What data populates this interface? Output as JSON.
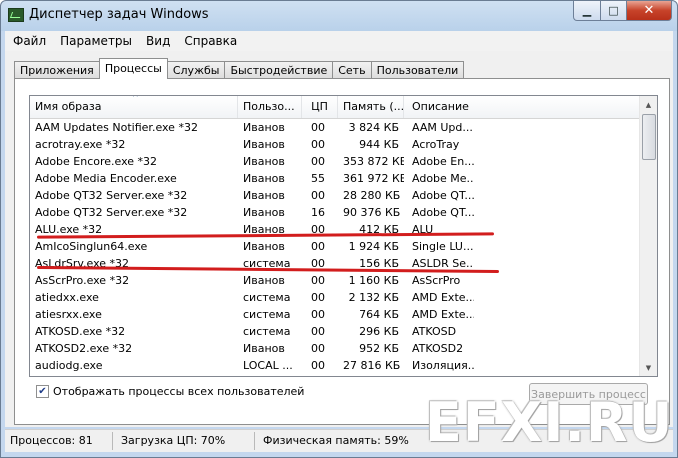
{
  "window": {
    "title": "Диспетчер задач Windows",
    "close_glyph": "✕",
    "min_glyph": "▁",
    "max_glyph": "□"
  },
  "menu": [
    "Файл",
    "Параметры",
    "Вид",
    "Справка"
  ],
  "tabs": [
    "Приложения",
    "Процессы",
    "Службы",
    "Быстродействие",
    "Сеть",
    "Пользователи"
  ],
  "active_tab": "Процессы",
  "columns": {
    "name": "Имя образа",
    "user": "Пользо...",
    "cpu": "ЦП",
    "mem": "Память (...",
    "desc": "Описание"
  },
  "sort_glyph": "^",
  "processes": [
    {
      "name": "AAM Updates Notifier.exe *32",
      "user": "Иванов",
      "cpu": "00",
      "mem": "3 824 КБ",
      "desc": "AAM Upd..."
    },
    {
      "name": "acrotray.exe *32",
      "user": "Иванов",
      "cpu": "00",
      "mem": "944 КБ",
      "desc": "AcroTray"
    },
    {
      "name": "Adobe Encore.exe *32",
      "user": "Иванов",
      "cpu": "00",
      "mem": "353 872 КБ",
      "desc": "Adobe En..."
    },
    {
      "name": "Adobe Media Encoder.exe",
      "user": "Иванов",
      "cpu": "55",
      "mem": "361 972 КБ",
      "desc": "Adobe Me..."
    },
    {
      "name": "Adobe QT32 Server.exe *32",
      "user": "Иванов",
      "cpu": "00",
      "mem": "28 280 КБ",
      "desc": "Adobe QT..."
    },
    {
      "name": "Adobe QT32 Server.exe *32",
      "user": "Иванов",
      "cpu": "16",
      "mem": "90 376 КБ",
      "desc": "Adobe QT..."
    },
    {
      "name": "ALU.exe *32",
      "user": "Иванов",
      "cpu": "00",
      "mem": "412 КБ",
      "desc": "ALU"
    },
    {
      "name": "AmIcoSinglun64.exe",
      "user": "Иванов",
      "cpu": "00",
      "mem": "1 924 КБ",
      "desc": "Single LU..."
    },
    {
      "name": "AsLdrSrv.exe *32",
      "user": "система",
      "cpu": "00",
      "mem": "156 КБ",
      "desc": "ASLDR Se..."
    },
    {
      "name": "AsScrPro.exe *32",
      "user": "Иванов",
      "cpu": "00",
      "mem": "1 160 КБ",
      "desc": "AsScrPro"
    },
    {
      "name": "atiedxx.exe",
      "user": "система",
      "cpu": "00",
      "mem": "2 132 КБ",
      "desc": "AMD Exte..."
    },
    {
      "name": "atiesrxx.exe",
      "user": "система",
      "cpu": "00",
      "mem": "764 КБ",
      "desc": "AMD Exte..."
    },
    {
      "name": "ATKOSD.exe *32",
      "user": "система",
      "cpu": "00",
      "mem": "296 КБ",
      "desc": "ATKOSD"
    },
    {
      "name": "ATKOSD2.exe *32",
      "user": "Иванов",
      "cpu": "00",
      "mem": "952 КБ",
      "desc": "ATKOSD2"
    },
    {
      "name": "audiodg.exe",
      "user": "LOCAL ...",
      "cpu": "00",
      "mem": "27 816 КБ",
      "desc": "Изоляция..."
    }
  ],
  "show_all_label": "Отображать процессы всех пользователей",
  "show_all_checked": true,
  "check_glyph": "✔",
  "end_process_label": "Завершить процесс",
  "status": {
    "processes": "Процессов: 81",
    "cpu": "Загрузка ЦП: 70%",
    "memory": "Физическая память: 59%"
  },
  "watermark": "EFXI.RU",
  "colors": {
    "annotation_red": "#d21d1d",
    "titlebar": "#b9d1ea",
    "close_button": "#c7432a"
  },
  "icons": [
    "taskmanager-icon",
    "minimize-icon",
    "maximize-icon",
    "close-icon",
    "scroll-up-icon",
    "scroll-down-icon",
    "checkmark-icon"
  ]
}
